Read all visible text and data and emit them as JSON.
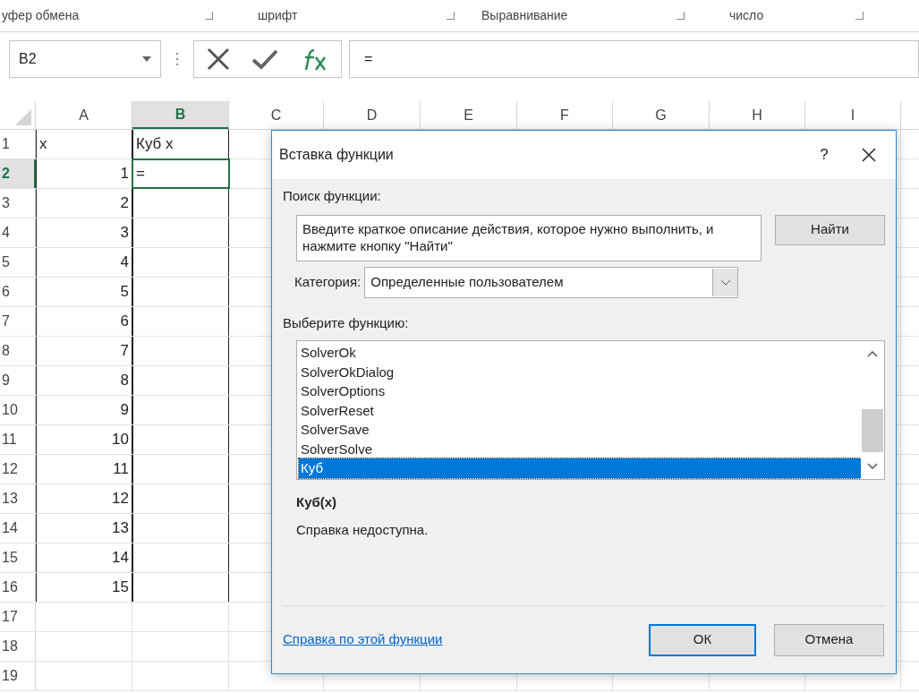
{
  "ribbon_groups": [
    "уфер обмена",
    "шрифт",
    "Выравнивание",
    "число"
  ],
  "name_box": "B2",
  "formula": "=",
  "columns": [
    {
      "label": "A",
      "selected": false
    },
    {
      "label": "B",
      "selected": true
    },
    {
      "label": "C",
      "selected": false
    },
    {
      "label": "D",
      "selected": false
    },
    {
      "label": "E",
      "selected": false
    },
    {
      "label": "F",
      "selected": false
    },
    {
      "label": "G",
      "selected": false
    },
    {
      "label": "H",
      "selected": false
    },
    {
      "label": "I",
      "selected": false
    }
  ],
  "rows": [
    {
      "label": "1",
      "selected": false,
      "cells": [
        "x",
        "Куб x"
      ]
    },
    {
      "label": "2",
      "selected": true,
      "cells": [
        "1",
        "="
      ]
    },
    {
      "label": "3",
      "selected": false,
      "cells": [
        "2",
        ""
      ]
    },
    {
      "label": "4",
      "selected": false,
      "cells": [
        "3",
        ""
      ]
    },
    {
      "label": "5",
      "selected": false,
      "cells": [
        "4",
        ""
      ]
    },
    {
      "label": "6",
      "selected": false,
      "cells": [
        "5",
        ""
      ]
    },
    {
      "label": "7",
      "selected": false,
      "cells": [
        "6",
        ""
      ]
    },
    {
      "label": "8",
      "selected": false,
      "cells": [
        "7",
        ""
      ]
    },
    {
      "label": "9",
      "selected": false,
      "cells": [
        "8",
        ""
      ]
    },
    {
      "label": "10",
      "selected": false,
      "cells": [
        "9",
        ""
      ]
    },
    {
      "label": "11",
      "selected": false,
      "cells": [
        "10",
        ""
      ]
    },
    {
      "label": "12",
      "selected": false,
      "cells": [
        "11",
        ""
      ]
    },
    {
      "label": "13",
      "selected": false,
      "cells": [
        "12",
        ""
      ]
    },
    {
      "label": "14",
      "selected": false,
      "cells": [
        "13",
        ""
      ]
    },
    {
      "label": "15",
      "selected": false,
      "cells": [
        "14",
        ""
      ]
    },
    {
      "label": "16",
      "selected": false,
      "cells": [
        "15",
        ""
      ]
    },
    {
      "label": "17",
      "selected": false,
      "cells": [
        "",
        ""
      ]
    },
    {
      "label": "18",
      "selected": false,
      "cells": [
        "",
        ""
      ]
    },
    {
      "label": "19",
      "selected": false,
      "cells": [
        "",
        ""
      ]
    }
  ],
  "dialog": {
    "title": "Вставка функции",
    "help": "?",
    "search_label": "Поиск функции:",
    "search_value": "Введите краткое описание действия, которое нужно выполнить, и нажмите кнопку \"Найти\"",
    "find_button": "Найти",
    "category_label": "Категория:",
    "category_value": "Определенные пользователем",
    "list_label": "Выберите функцию:",
    "functions": [
      {
        "label": "SolverOk",
        "selected": false
      },
      {
        "label": "SolverOkDialog",
        "selected": false
      },
      {
        "label": "SolverOptions",
        "selected": false
      },
      {
        "label": "SolverReset",
        "selected": false
      },
      {
        "label": "SolverSave",
        "selected": false
      },
      {
        "label": "SolverSolve",
        "selected": false
      },
      {
        "label": "Куб",
        "selected": true
      }
    ],
    "signature": "Куб(x)",
    "description": "Справка недоступна.",
    "help_link": "Справка по этой функции",
    "ok_button": "ОК",
    "cancel_button": "Отмена"
  }
}
